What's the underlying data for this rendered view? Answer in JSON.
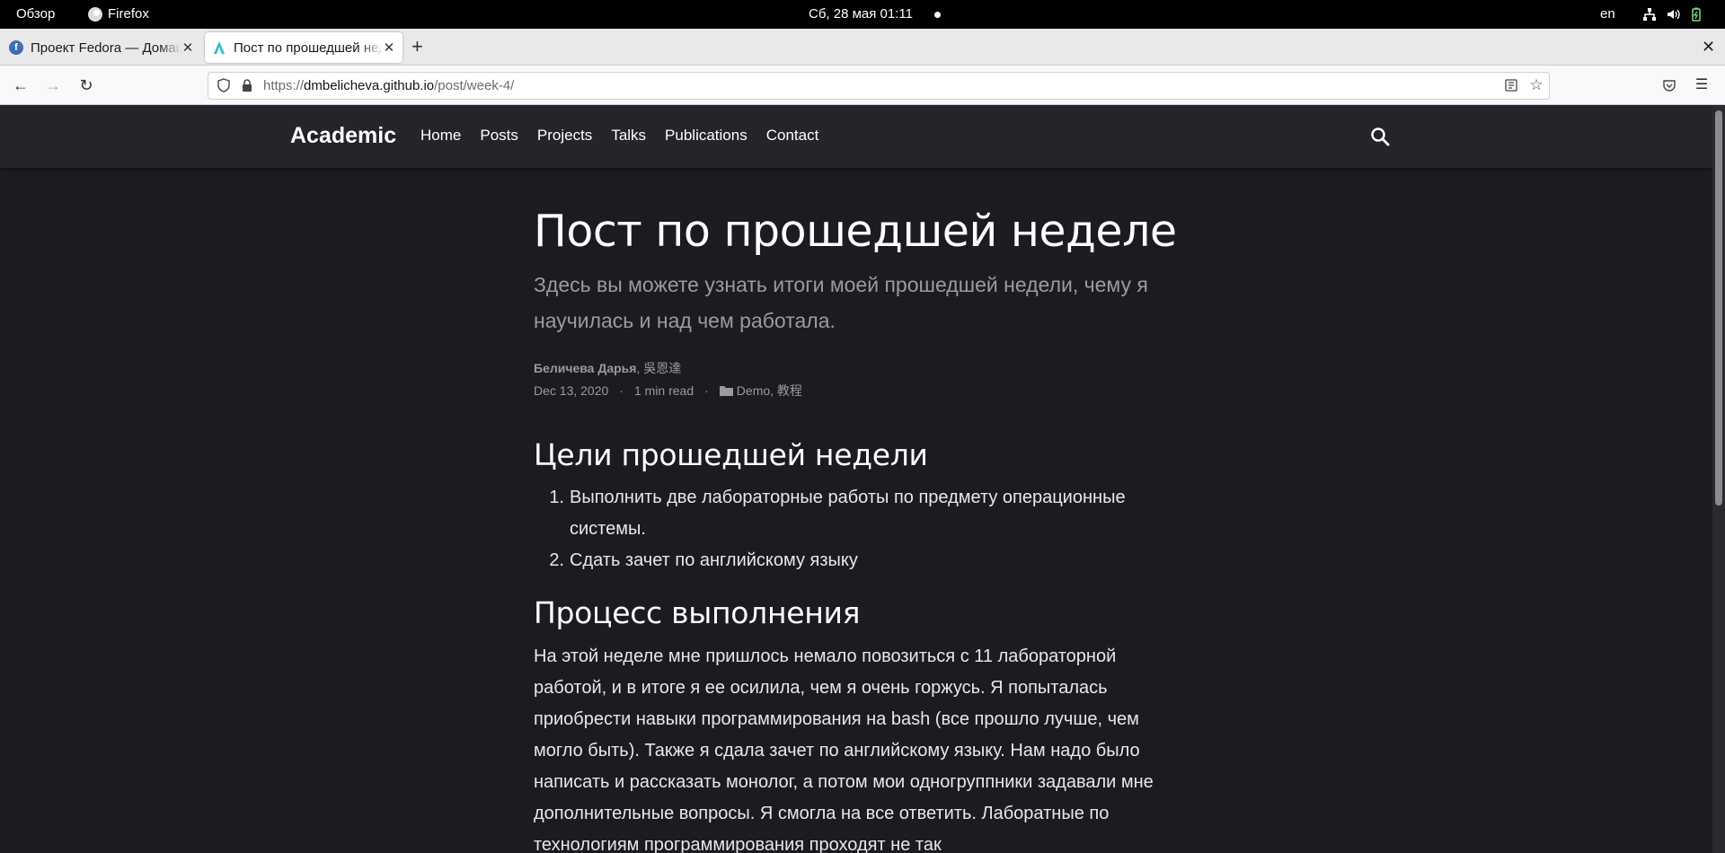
{
  "system_bar": {
    "overview": "Обзор",
    "app_name": "Firefox",
    "clock": "Сб, 28 мая  01:11",
    "lang": "en"
  },
  "tabs": [
    {
      "title": "Проект Fedora — Домашняя страница",
      "favicon": "fedora-icon"
    },
    {
      "title": "Пост по прошедшей неделе",
      "favicon": "academic-icon"
    }
  ],
  "urlbar": {
    "scheme": "https://",
    "domain": "dmbelicheva.github.io",
    "path": "/post/week-4/"
  },
  "site": {
    "brand": "Academic",
    "menu": [
      "Home",
      "Posts",
      "Projects",
      "Talks",
      "Publications",
      "Contact"
    ]
  },
  "article": {
    "title": "Пост по прошедшей неделе",
    "subtitle": "Здесь вы можете узнать итоги моей прошедшей недели, чему я научилась и над чем работала.",
    "author_main": "Беличева Дарья",
    "author_rest": ", 吳恩達",
    "date": "Dec 13, 2020",
    "sep": "·",
    "read_time": "1 min read",
    "categories": "Demo, 教程",
    "h2_goals": "Цели прошедшей недели",
    "goals": [
      {
        "num": "1.",
        "text": "Выполнить две лабораторные работы по предмету операционные системы."
      },
      {
        "num": "2.",
        "text": "Сдать зачет по английскому языку"
      }
    ],
    "h2_process": "Процесс выполнения",
    "body": "На этой неделе мне пришлось немало повозиться с 11 лабораторной работой, и в итоге я ее осилила, чем я очень горжусь. Я попыталась приобрести навыки программирования на bash (все прошло лучше, чем могло быть). Также я сдала зачет по английскому языку. Нам надо было написать и рассказать монолог, а потом мои одногруппники задавали мне дополнительные вопросы. Я смогла на все ответить. Лаборатные по технологиям программирования проходят не так"
  },
  "colors": {
    "page_bg": "#1b1c22",
    "nav_bg": "#24252b",
    "muted_text": "#9a9ba0"
  }
}
